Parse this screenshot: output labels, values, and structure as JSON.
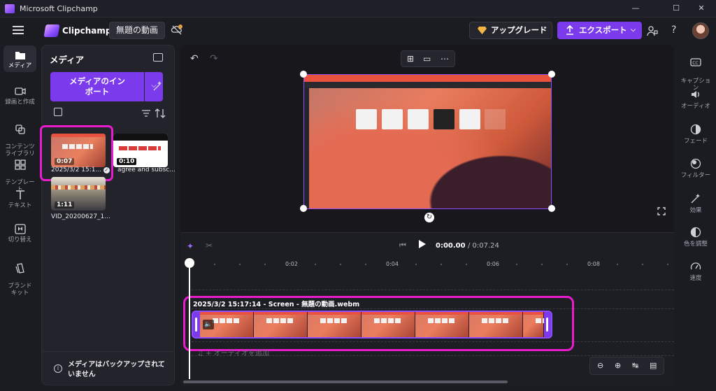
{
  "window": {
    "title": "Microsoft Clipchamp",
    "controls": [
      "—",
      "☐",
      "✕"
    ]
  },
  "header": {
    "brand": "Clipchamp",
    "project_name": "無題の動画",
    "upgrade_label": "アップグレード",
    "export_label": "エクスポート",
    "help": "?"
  },
  "left_nav": [
    {
      "label": "メディア",
      "icon": "folder-icon",
      "active": true
    },
    {
      "label": "録画と作成",
      "icon": "camera-icon"
    },
    {
      "label": "コンテンツ\nライブラリ",
      "icon": "library-icon"
    },
    {
      "label": "テンプレー\nト",
      "icon": "templates-icon"
    },
    {
      "label": "テキスト",
      "icon": "text-icon"
    },
    {
      "label": "切り替え",
      "icon": "transitions-icon"
    },
    {
      "label": "ブランド\nキット",
      "icon": "brand-kit-icon"
    }
  ],
  "media_panel": {
    "title": "メディア",
    "import_label": "メディアのイン\nポート",
    "items": [
      {
        "duration": "0:07",
        "label": "2025/3/2 15:1...",
        "selected": true
      },
      {
        "duration": "0:10",
        "label": "agree and subsc..."
      },
      {
        "duration": "1:11",
        "label": "VID_20200627_1..."
      }
    ],
    "backup_notice": "メディアはバックアップされて\nいません"
  },
  "preview": {
    "undo": "↶",
    "redo": "↷"
  },
  "timeline": {
    "current_time": "0:00.00",
    "total_time": "/ 0:07.24",
    "ruler_labels": [
      "0:02",
      "0:04",
      "0:06",
      "0:08"
    ],
    "clip_name": "2025/3/2 15:17:14 - Screen - 無題の動画.webm",
    "add_audio": "♫ + オーディオを追加"
  },
  "right_nav": [
    {
      "label": "キャプショ\nン",
      "icon": "captions-icon"
    },
    {
      "label": "オーディオ",
      "icon": "audio-icon"
    },
    {
      "label": "フェード",
      "icon": "fade-icon"
    },
    {
      "label": "フィルター",
      "icon": "filter-icon"
    },
    {
      "label": "効果",
      "icon": "effects-icon"
    },
    {
      "label": "色を調整",
      "icon": "color-adjust-icon"
    },
    {
      "label": "速度",
      "icon": "speed-icon"
    }
  ],
  "colors": {
    "accent": "#7c3aed",
    "highlight_ring": "#e81ccd",
    "background": "#1b1b22"
  }
}
